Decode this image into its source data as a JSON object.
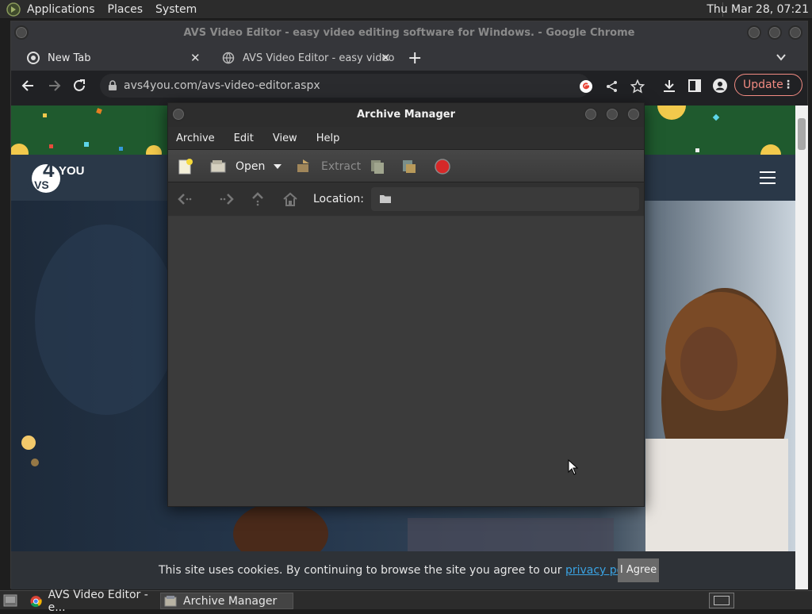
{
  "top_panel": {
    "menus": [
      "Applications",
      "Places",
      "System"
    ],
    "clock": "Thu Mar 28, 07:21"
  },
  "chrome": {
    "window_title": "AVS Video Editor - easy video editing software for Windows. - Google Chrome",
    "tabs": [
      {
        "label": "New Tab"
      },
      {
        "label": "AVS Video Editor - easy video"
      }
    ],
    "url": "avs4you.com/avs-video-editor.aspx",
    "update_label": "Update"
  },
  "page": {
    "logo_text": "AVS",
    "cookie_text": "This site uses cookies. By continuing to browse the site you agree to our ",
    "cookie_link": "privacy policy",
    "cookie_period": ".",
    "agree_label": "I Agree"
  },
  "archive_manager": {
    "title": "Archive Manager",
    "menus": [
      "Archive",
      "Edit",
      "View",
      "Help"
    ],
    "toolbar": {
      "open_label": "Open",
      "extract_label": "Extract"
    },
    "location_label": "Location:"
  },
  "taskbar": {
    "items": [
      {
        "label": "AVS Video Editor - e..."
      },
      {
        "label": "Archive Manager"
      }
    ]
  }
}
